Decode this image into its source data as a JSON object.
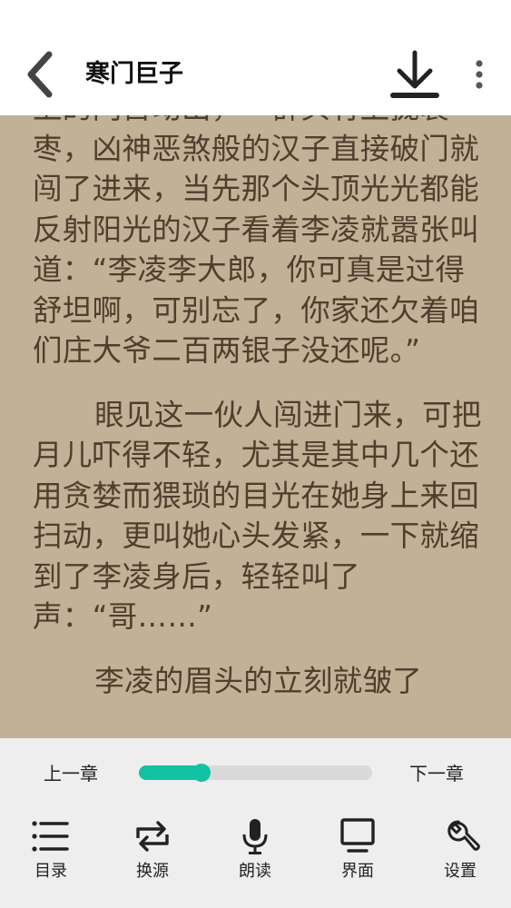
{
  "header": {
    "title": "寒门巨子"
  },
  "reader": {
    "paragraphs": [
      {
        "text": "上的门首动出，一群头有上拢裂枣，凶神恶煞般的汉子直接破门就闯了进来，当先那个头顶光光都能反射阳光的汉子看着李凌就嚣张叫道：“李凌李大郎，你可真是过得舒坦啊，可别忘了，你家还欠着咱们庄大爷二百两银子没还呢。”",
        "indent": false
      },
      {
        "text": "眼见这一伙人闯进门来，可把月儿吓得不轻，尤其是其中几个还用贪婪而猥琐的目光在她身上来回扫动，更叫她心头发紧，一下就缩到了李凌身后，轻轻叫了声：“哥……”",
        "indent": true
      },
      {
        "text": "李凌的眉头的立刻就皱了",
        "indent": true
      }
    ]
  },
  "bottom": {
    "prev_chapter": "上一章",
    "next_chapter": "下一章",
    "progress_fraction": 0.27,
    "tools": [
      {
        "label": "目录",
        "icon": "list-icon"
      },
      {
        "label": "换源",
        "icon": "switch-source-icon"
      },
      {
        "label": "朗读",
        "icon": "microphone-icon"
      },
      {
        "label": "界面",
        "icon": "monitor-icon"
      },
      {
        "label": "设置",
        "icon": "wrench-icon"
      }
    ]
  },
  "colors": {
    "reader_background": "#c1b197",
    "reader_text": "#4f3e2c",
    "accent": "#12c2a3",
    "toolbar_background": "#eeeeee"
  }
}
